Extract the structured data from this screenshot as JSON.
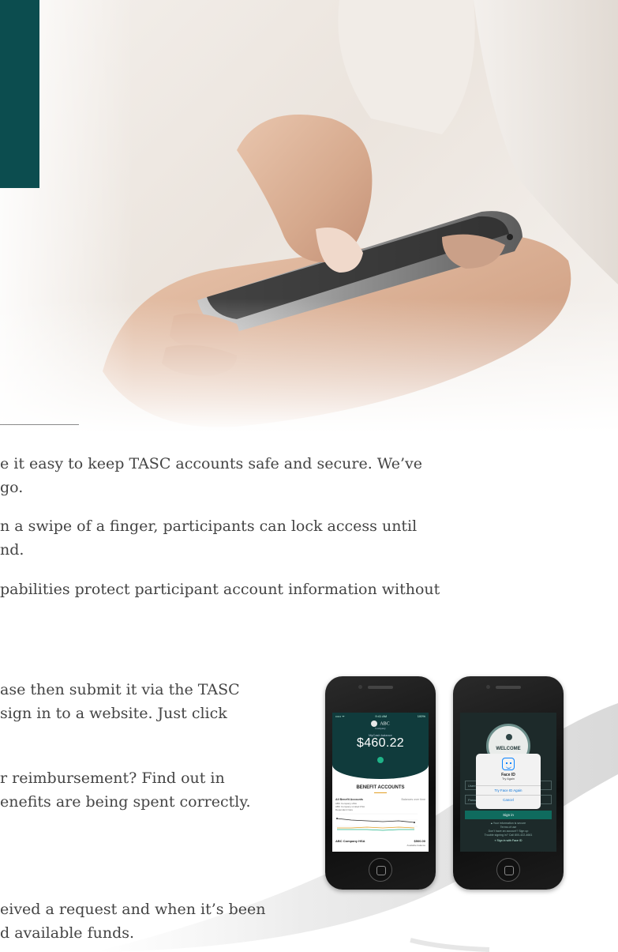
{
  "paragraphs": [
    {
      "line1": "e it easy to keep TASC accounts safe and secure. We’ve",
      "line2": "go."
    },
    {
      "line1": "n a swipe of a finger, participants can lock access until",
      "line2": "nd."
    },
    {
      "line1": "pabilities protect participant account information without",
      "line2": ""
    },
    {
      "line1": "ase then submit it via the TASC",
      "line2": "sign in to a website. Just click"
    },
    {
      "line1": "r reimbursement? Find out in",
      "line2": "enefits are being spent correctly."
    },
    {
      "line1": "eived a request and when it’s been",
      "line2": "d available funds."
    }
  ],
  "phone1": {
    "status_left": "••••• ᯤ",
    "status_time": "9:41 AM",
    "status_right": "100%",
    "logo_text": "ABC",
    "logo_sub": "Company",
    "balance_label": "MyCash balance",
    "balance_amount": "$460.22",
    "section_title": "BENEFIT ACCOUNTS",
    "list_title": "All Benefit Accounts",
    "list_link": "Balances over time",
    "legend": [
      "ABC Company HSA",
      "ABC Company Limited FSA",
      "Dependent Care"
    ],
    "account_name": "ABC Company HSA",
    "account_amount": "$500.00",
    "account_sub": "Available balance"
  },
  "phone2": {
    "badge_text": "WELCOME",
    "field_user": "Username",
    "field_pass": "Password",
    "modal_title": "Face ID",
    "modal_sub": "Try Again",
    "modal_retry": "Try Face ID Again",
    "modal_cancel": "Cancel",
    "signin_label": "Sign in",
    "secure_text": "Your information is secure",
    "terms_text": "Terms of use",
    "signup_text": "Don't have an account? Sign up",
    "trouble_text": "Trouble signing in? Call 800-422-4661",
    "faceid_text": "Sign in with Face ID"
  },
  "colors": {
    "teal_block": "#0c4d4f",
    "screen_header": "#103b3c",
    "accent_green": "#1fb388",
    "accent_orange": "#e3a027"
  }
}
